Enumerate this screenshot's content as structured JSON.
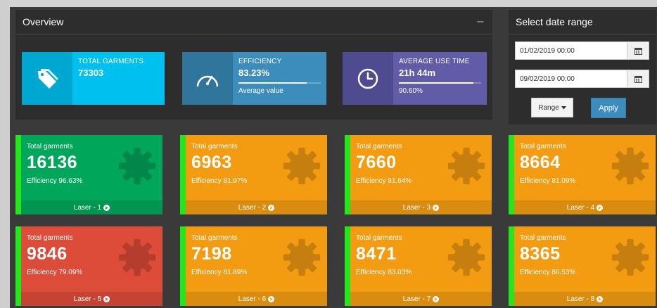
{
  "overview": {
    "title": "Overview",
    "collapse_label": "–",
    "boxes": [
      {
        "label": "TOTAL GARMENTS",
        "value": "73303",
        "icon": "tag-icon"
      },
      {
        "label": "EFFICIENCY",
        "value": "83.23%",
        "progress": 0.8323,
        "description": "Average value",
        "icon": "speedometer-icon"
      },
      {
        "label": "AVERAGE USE TIME",
        "value": "21h 44m",
        "progress": 0.906,
        "description": "90.60%",
        "icon": "clock-icon"
      }
    ]
  },
  "date_range": {
    "title": "Select date range",
    "start": "01/02/2019 00:00",
    "end": "09/02/2019 00:00",
    "range_label": "Range",
    "apply_label": "Apply"
  },
  "machines": [
    {
      "label": "Total garments",
      "value": "16136",
      "efficiency": "Efficiency 96.63%",
      "footer": "Laser - 1",
      "color": "#00a65a"
    },
    {
      "label": "Total garments",
      "value": "6963",
      "efficiency": "Efficiency 81.97%",
      "footer": "Laser - 2",
      "color": "#f39c12"
    },
    {
      "label": "Total garments",
      "value": "7660",
      "efficiency": "Efficiency 81.64%",
      "footer": "Laser - 3",
      "color": "#f39c12"
    },
    {
      "label": "Total garments",
      "value": "8664",
      "efficiency": "Efficiency 81.09%",
      "footer": "Laser - 4",
      "color": "#f39c12"
    },
    {
      "label": "Total garments",
      "value": "9846",
      "efficiency": "Efficiency 79.09%",
      "footer": "Laser - 5",
      "color": "#dd4b39"
    },
    {
      "label": "Total garments",
      "value": "7198",
      "efficiency": "Efficiency 81.89%",
      "footer": "Laser - 6",
      "color": "#f39c12"
    },
    {
      "label": "Total garments",
      "value": "8471",
      "efficiency": "Efficiency 83.03%",
      "footer": "Laser - 7",
      "color": "#f39c12"
    },
    {
      "label": "Total garments",
      "value": "8365",
      "efficiency": "Efficiency 80.53%",
      "footer": "Laser - 8",
      "color": "#f39c12"
    }
  ],
  "colors": {
    "status_indicator": "#23e71c"
  }
}
